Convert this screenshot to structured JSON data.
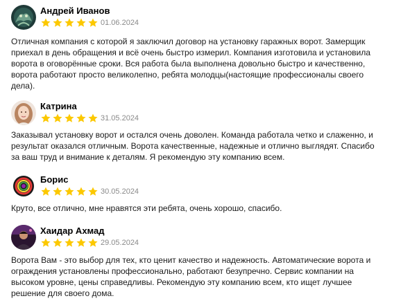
{
  "colors": {
    "star": "#fcc800",
    "date": "#8a8a8a",
    "text": "#1a1a1a"
  },
  "reviews": [
    {
      "author": "Андрей Иванов",
      "rating": 5,
      "date": "01.06.2024",
      "avatar_icon": "dragon-avatar-icon",
      "text": "Отличная компания с которой я заключил договор на установку гаражных ворот. Замерщик приехал в день обращения и всё очень быстро измерил. Компания изготовила и установила ворота в оговорённые сроки. Вся работа была выполнена довольно быстро и качественно, ворота работают просто великолепно, ребята молодцы(настоящие профессионалы своего дела)."
    },
    {
      "author": "Катрина",
      "rating": 5,
      "date": "31.05.2024",
      "avatar_icon": "girl-portrait-avatar-icon",
      "text": "Заказывал установку ворот и остался очень доволен. Команда работала четко и слаженно, и результат оказался отличным. Ворота качественные, надежные и отлично выглядят. Спасибо за ваш труд и внимание к деталям. Я рекомендую эту компанию всем."
    },
    {
      "author": "Борис",
      "rating": 5,
      "date": "30.05.2024",
      "avatar_icon": "colorful-ring-avatar-icon",
      "text": "Круто, все отлично, мне нравятся эти ребята, очень хорошо, спасибо."
    },
    {
      "author": "Хаидар Ахмад",
      "rating": 5,
      "date": "29.05.2024",
      "avatar_icon": "man-portrait-avatar-icon",
      "text": "Ворота Вам - это выбор для тех, кто ценит качество и надежность. Автоматические ворота и ограждения установлены профессионально, работают безупречно. Сервис компании на высоком уровне, цены справедливы. Рекомендую эту компанию всем, кто ищет лучшее решение для своего дома."
    }
  ]
}
